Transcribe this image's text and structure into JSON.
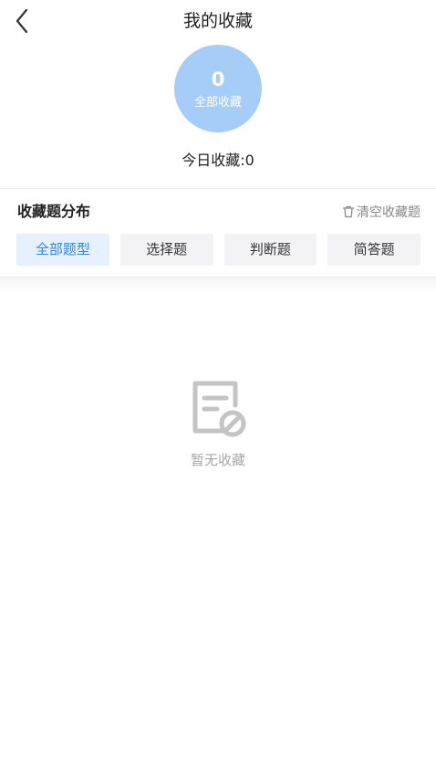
{
  "header": {
    "title": "我的收藏",
    "back_icon": "chevron-left-icon"
  },
  "stats": {
    "total_count": "0",
    "total_label": "全部收藏",
    "today_text": "今日收藏:0",
    "circle_color": "#a6cdf8"
  },
  "section": {
    "title": "收藏题分布",
    "clear_icon": "trash-icon",
    "clear_label": "清空收藏题"
  },
  "tabs": [
    {
      "label": "全部题型",
      "active": true
    },
    {
      "label": "选择题",
      "active": false
    },
    {
      "label": "判断题",
      "active": false
    },
    {
      "label": "简答题",
      "active": false
    }
  ],
  "empty": {
    "icon": "empty-document-icon",
    "text": "暂无收藏"
  },
  "colors": {
    "accent": "#2f86e6",
    "active_tab_bg": "#e7f1fd",
    "tab_bg": "#f3f3f5",
    "muted_text": "#a8a8a8"
  }
}
